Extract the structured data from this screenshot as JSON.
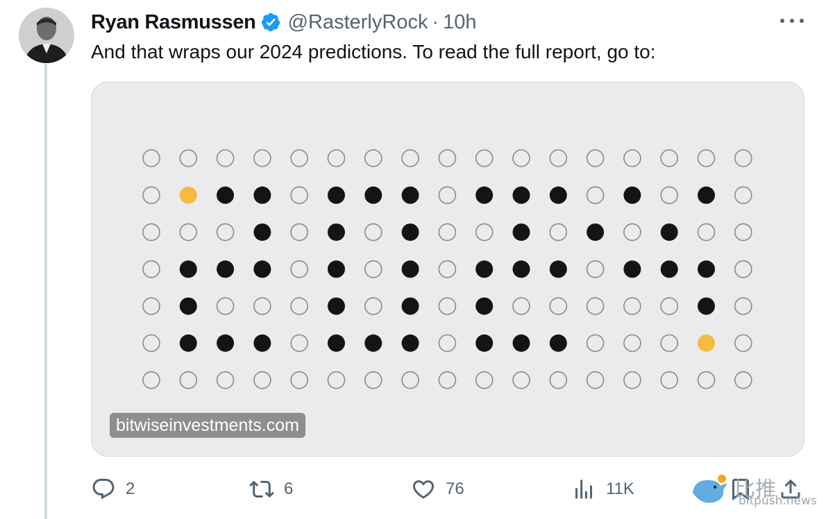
{
  "tweet": {
    "author_name": "Ryan Rasmussen",
    "handle": "@RasterlyRock",
    "separator": "·",
    "time": "10h",
    "text": "And that wraps our 2024 predictions. To read the full report, go to:"
  },
  "card": {
    "domain": "bitwiseinvestments.com",
    "grid": {
      "rows": [
        "OOOOOOOOOOOOOOOOO",
        "OYXXOXXXOXXXOXOXO",
        "OOOXOXOXOOXOXOXO O",
        "OXXXOXOXOXXXOXXXO",
        "OXOOOXOXOXOOOOOXO",
        "OXXXOXXXOXXXOOOYO",
        "OOOOOOOOOOOOOOOOO"
      ],
      "legend_note": "O = empty circle, X = black dot, Y = yellow dot",
      "colors": {
        "filled": "#141414",
        "accent": "#f5bb40",
        "empty_stroke": "#8a8a8a"
      }
    }
  },
  "actions": {
    "reply": {
      "icon": "reply-icon",
      "count": "2"
    },
    "retweet": {
      "icon": "retweet-icon",
      "count": "6"
    },
    "like": {
      "icon": "heart-icon",
      "count": "76"
    },
    "views": {
      "icon": "analytics-icon",
      "count": "11K"
    },
    "bookmark": {
      "icon": "bookmark-icon"
    },
    "share": {
      "icon": "share-icon"
    }
  },
  "watermark": {
    "cn_text": "比推",
    "site": "bitpush.news"
  },
  "colors": {
    "text": "#0f1419",
    "secondary": "#536471",
    "verified": "#1d9bf0",
    "card_bg": "#ebebed"
  }
}
